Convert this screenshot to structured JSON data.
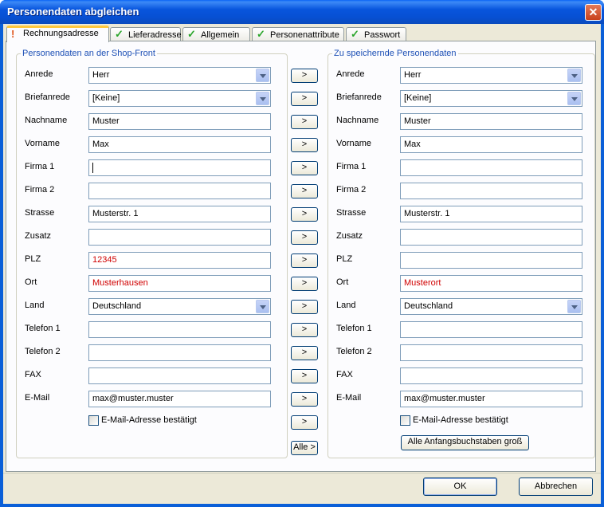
{
  "window": {
    "title": "Personendaten abgleichen",
    "close_glyph": "✕"
  },
  "tabs": [
    {
      "label": "Rechnungsadresse",
      "icon": "warning-icon",
      "glyph": "!",
      "active": true
    },
    {
      "label": "Lieferadresse",
      "icon": "check-icon",
      "glyph": "✓",
      "active": false
    },
    {
      "label": "Allgemein",
      "icon": "check-icon",
      "glyph": "✓",
      "active": false
    },
    {
      "label": "Personenattribute",
      "icon": "check-icon",
      "glyph": "✓",
      "active": false
    },
    {
      "label": "Passwort",
      "icon": "check-icon",
      "glyph": "✓",
      "active": false
    }
  ],
  "left": {
    "title": "Personendaten an der Shop-Front",
    "fields": [
      {
        "label": "Anrede",
        "value": "Herr",
        "type": "combo"
      },
      {
        "label": "Briefanrede",
        "value": "[Keine]",
        "type": "combo"
      },
      {
        "label": "Nachname",
        "value": "Muster",
        "type": "text"
      },
      {
        "label": "Vorname",
        "value": "Max",
        "type": "text"
      },
      {
        "label": "Firma 1",
        "value": "",
        "type": "text",
        "focused": true
      },
      {
        "label": "Firma 2",
        "value": "",
        "type": "text"
      },
      {
        "label": "Strasse",
        "value": "Musterstr. 1",
        "type": "text"
      },
      {
        "label": "Zusatz",
        "value": "",
        "type": "text"
      },
      {
        "label": "PLZ",
        "value": "12345",
        "type": "text",
        "highlight": true
      },
      {
        "label": "Ort",
        "value": "Musterhausen",
        "type": "text",
        "highlight": true
      },
      {
        "label": "Land",
        "value": "Deutschland",
        "type": "combo"
      },
      {
        "label": "Telefon 1",
        "value": "",
        "type": "text"
      },
      {
        "label": "Telefon 2",
        "value": "",
        "type": "text"
      },
      {
        "label": "FAX",
        "value": "",
        "type": "text"
      },
      {
        "label": "E-Mail",
        "value": "max@muster.muster",
        "type": "text"
      }
    ],
    "checkbox_label": "E-Mail-Adresse bestätigt"
  },
  "right": {
    "title": "Zu speichernde Personendaten",
    "fields": [
      {
        "label": "Anrede",
        "value": "Herr",
        "type": "combo"
      },
      {
        "label": "Briefanrede",
        "value": "[Keine]",
        "type": "combo"
      },
      {
        "label": "Nachname",
        "value": "Muster",
        "type": "text"
      },
      {
        "label": "Vorname",
        "value": "Max",
        "type": "text"
      },
      {
        "label": "Firma 1",
        "value": "",
        "type": "text"
      },
      {
        "label": "Firma 2",
        "value": "",
        "type": "text"
      },
      {
        "label": "Strasse",
        "value": "Musterstr. 1",
        "type": "text"
      },
      {
        "label": "Zusatz",
        "value": "",
        "type": "text"
      },
      {
        "label": "PLZ",
        "value": "",
        "type": "text"
      },
      {
        "label": "Ort",
        "value": "Musterort",
        "type": "text",
        "highlight": true
      },
      {
        "label": "Land",
        "value": "Deutschland",
        "type": "combo"
      },
      {
        "label": "Telefon 1",
        "value": "",
        "type": "text"
      },
      {
        "label": "Telefon 2",
        "value": "",
        "type": "text"
      },
      {
        "label": "FAX",
        "value": "",
        "type": "text"
      },
      {
        "label": "E-Mail",
        "value": "max@muster.muster",
        "type": "text"
      }
    ],
    "checkbox_label": "E-Mail-Adresse bestätigt",
    "capitalize_button": "Alle Anfangsbuchstaben groß"
  },
  "copy_button_label": ">",
  "copy_all_label": "Alle >",
  "footer": {
    "ok": "OK",
    "cancel": "Abbrechen"
  },
  "colors": {
    "highlight_text": "#d00000",
    "group_title": "#1c4fb5",
    "tab_active_accent": "#ffc83c"
  }
}
